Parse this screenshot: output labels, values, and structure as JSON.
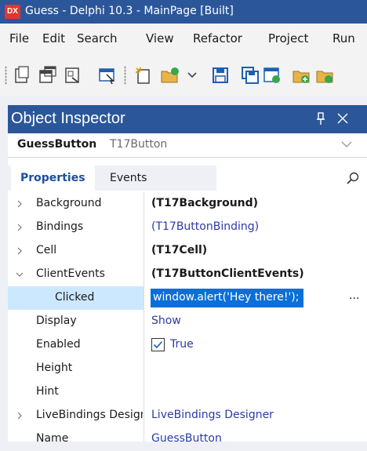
{
  "window": {
    "title": "Guess - Delphi 10.3 - MainPage [Built]",
    "app_icon_text": "DX"
  },
  "menu": [
    {
      "label": "File"
    },
    {
      "label": "Edit"
    },
    {
      "label": "Search"
    },
    {
      "label": "View"
    },
    {
      "label": "Refactor"
    },
    {
      "label": "Project"
    },
    {
      "label": "Run"
    }
  ],
  "inspector": {
    "title": "Object Inspector",
    "selected_name": "GuessButton",
    "selected_type": "T17Button",
    "tabs": {
      "properties": "Properties",
      "events": "Events"
    },
    "rows": [
      {
        "name": "Background",
        "value": "(T17Background)"
      },
      {
        "name": "Bindings",
        "value": "(T17ButtonBinding)"
      },
      {
        "name": "Cell",
        "value": "(T17Cell)"
      },
      {
        "name": "ClientEvents",
        "value": "(T17ButtonClientEvents)"
      },
      {
        "name": "Clicked",
        "value": "window.alert('Hey there!');",
        "ellipsis": "..."
      },
      {
        "name": "Display",
        "value": "Show"
      },
      {
        "name": "Enabled",
        "value": "True"
      },
      {
        "name": "Height",
        "value": ""
      },
      {
        "name": "Hint",
        "value": ""
      },
      {
        "name": "LiveBindings Designer",
        "value": "LiveBindings Designer"
      },
      {
        "name": "Name",
        "value": "GuessButton"
      }
    ]
  },
  "colors": {
    "accent": "#2b579a",
    "selection": "#0a6fd8",
    "link": "#2b3aa8"
  }
}
